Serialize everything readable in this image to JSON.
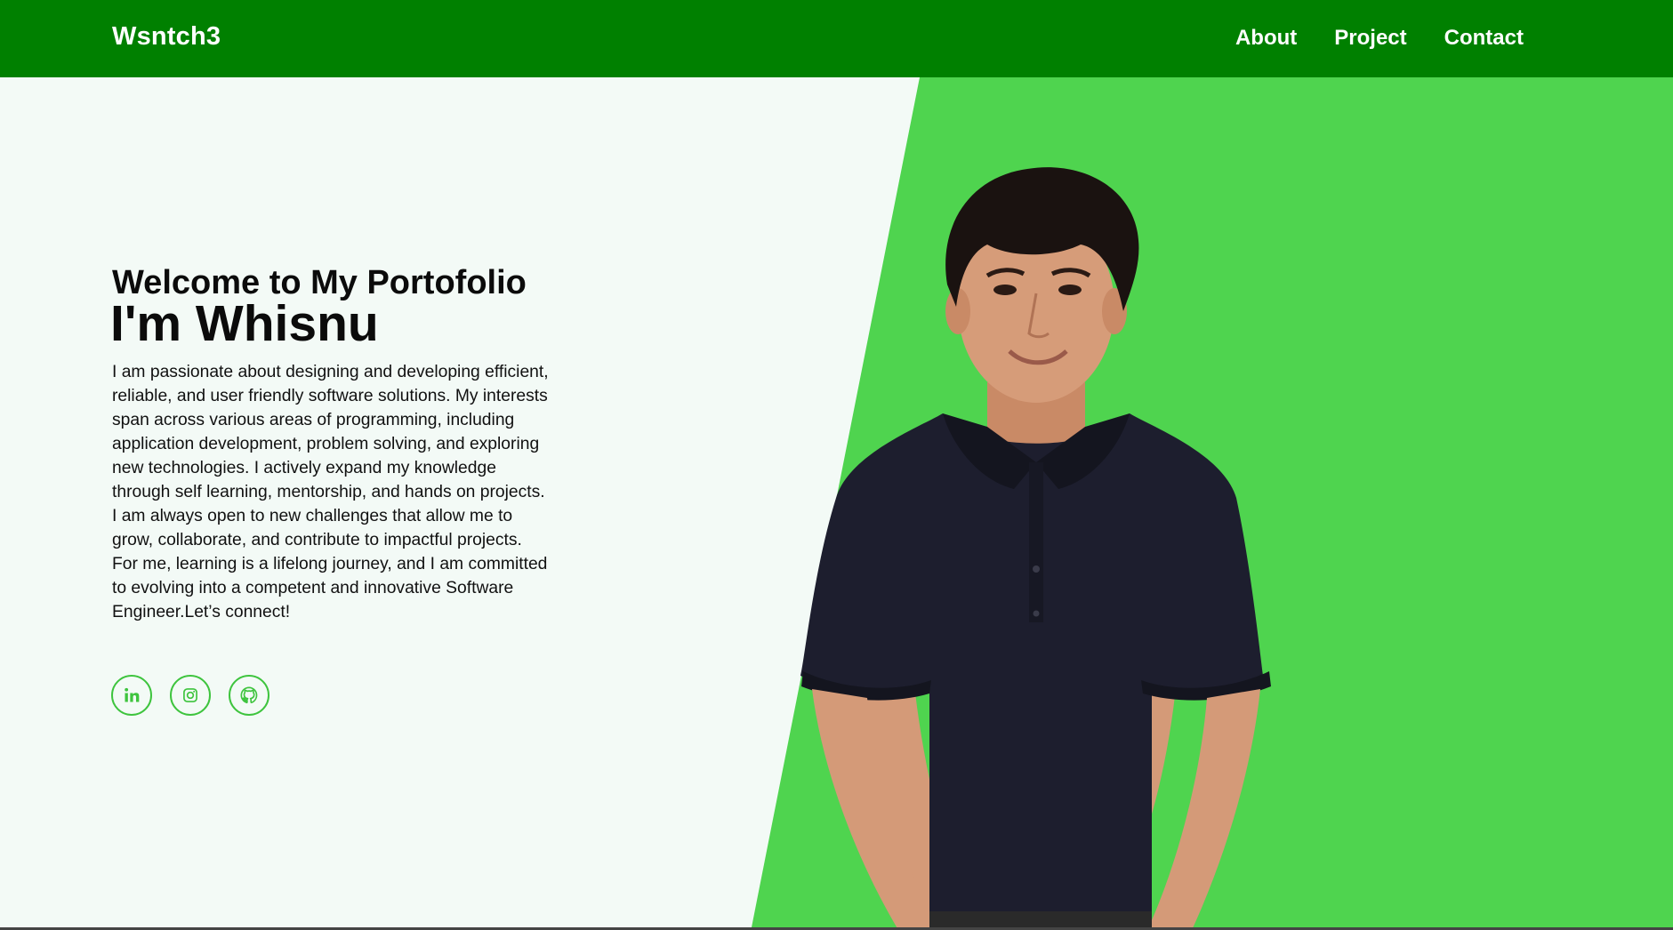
{
  "navbar": {
    "brand": "Wsntch3",
    "links": [
      {
        "label": "About"
      },
      {
        "label": "Project"
      },
      {
        "label": "Contact"
      }
    ]
  },
  "hero": {
    "welcome": "Welcome to My Portofolio",
    "name": "I'm Whisnu",
    "bio": "I am passionate about designing and developing efficient, reliable, and user friendly software solutions. My interests span across various areas of programming, including application development, problem solving, and exploring new technologies. I actively expand my knowledge through self learning, mentorship, and hands on projects. I am always open to new challenges that allow me to grow, collaborate, and contribute to impactful projects. For me, learning is a lifelong journey, and I am committed to evolving into a competent and innovative Software Engineer.Let’s connect!",
    "socials": [
      {
        "icon": "linkedin-icon"
      },
      {
        "icon": "instagram-icon"
      },
      {
        "icon": "github-icon"
      }
    ]
  },
  "colors": {
    "navbar": "#008000",
    "accent_green": "#4fd44f",
    "icon_green": "#3ec43e",
    "background": "#f3faf6",
    "text": "#0b0b0b"
  }
}
